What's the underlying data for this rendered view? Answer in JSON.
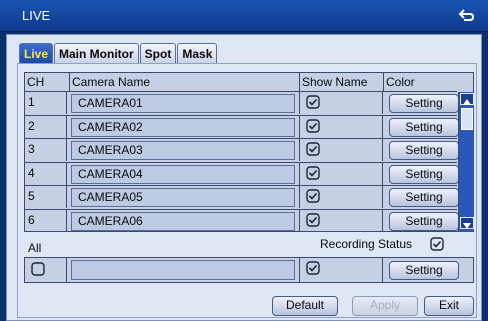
{
  "window": {
    "title": "LIVE",
    "back_icon": "back-arrow-icon"
  },
  "tabs": [
    {
      "label": "Live",
      "active": true
    },
    {
      "label": "Main Monitor",
      "active": false
    },
    {
      "label": "Spot",
      "active": false
    },
    {
      "label": "Mask",
      "active": false
    }
  ],
  "table": {
    "headers": {
      "ch": "CH",
      "name": "Camera Name",
      "show": "Show Name",
      "color": "Color"
    },
    "rows": [
      {
        "ch": "1",
        "name": "CAMERA01",
        "show_name": true,
        "color_button": "Setting"
      },
      {
        "ch": "2",
        "name": "CAMERA02",
        "show_name": true,
        "color_button": "Setting"
      },
      {
        "ch": "3",
        "name": "CAMERA03",
        "show_name": true,
        "color_button": "Setting"
      },
      {
        "ch": "4",
        "name": "CAMERA04",
        "show_name": true,
        "color_button": "Setting"
      },
      {
        "ch": "5",
        "name": "CAMERA05",
        "show_name": true,
        "color_button": "Setting"
      },
      {
        "ch": "6",
        "name": "CAMERA06",
        "show_name": true,
        "color_button": "Setting"
      }
    ]
  },
  "all": {
    "label": "All",
    "checked": false,
    "name": "",
    "show_name": true,
    "color_button": "Setting"
  },
  "recording_status": {
    "label": "Recording Status",
    "checked": true
  },
  "buttons": {
    "default": "Default",
    "apply": "Apply",
    "exit": "Exit"
  },
  "colors": {
    "title_bar": "#1a54b4",
    "active_tab_text": "#ffe54a",
    "scrollbar": "#2a58b8"
  }
}
